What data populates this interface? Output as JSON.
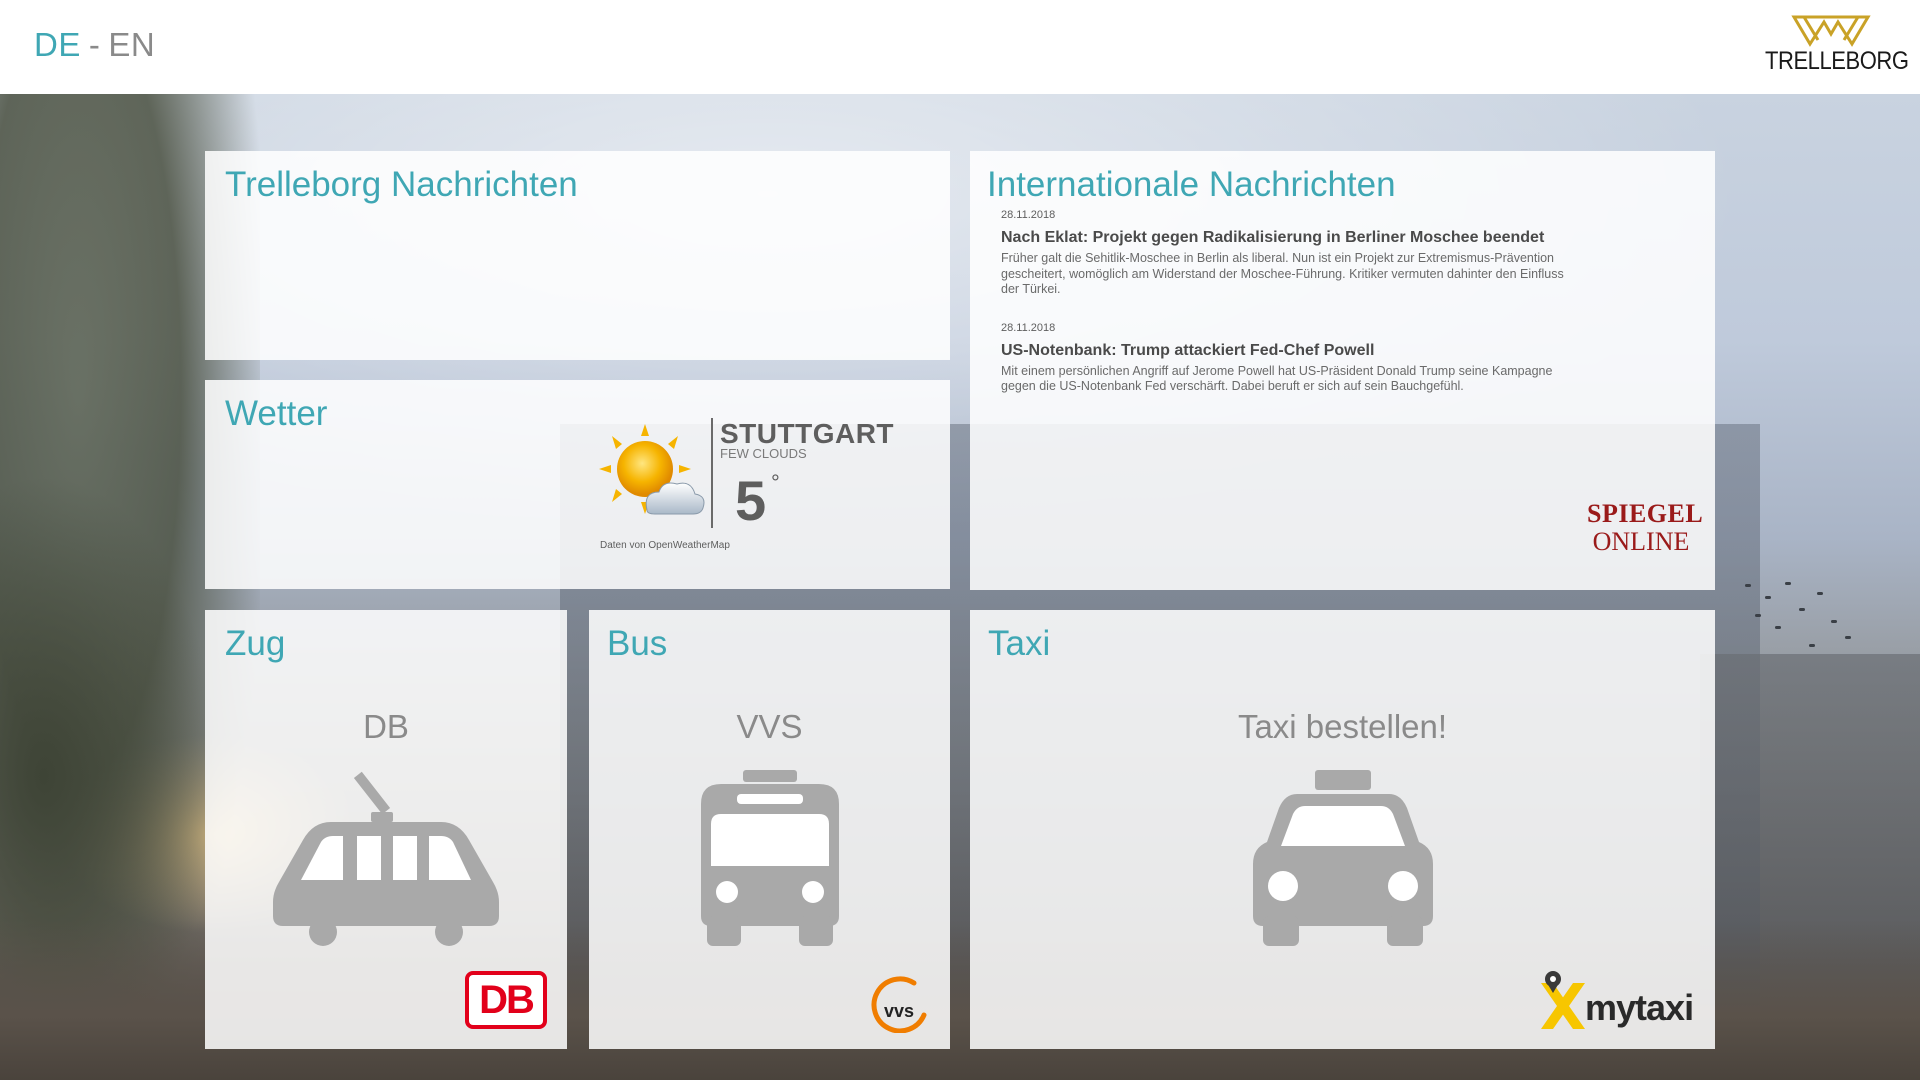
{
  "header": {
    "lang_de": "DE",
    "lang_sep": "-",
    "lang_en": "EN",
    "logo_text": "TRELLEBORG"
  },
  "panels": {
    "trelleborg_news": {
      "title": "Trelleborg Nachrichten"
    },
    "weather": {
      "title": "Wetter",
      "city": "STUTTGART",
      "condition": "FEW CLOUDS",
      "temperature": "5",
      "degree": "°",
      "credit": "Daten von OpenWeatherMap",
      "icon": "sun-with-cloud-icon"
    },
    "intl_news": {
      "title": "Internationale Nachrichten",
      "items": [
        {
          "date": "28.11.2018",
          "headline": "Nach Eklat: Projekt gegen Radikalisierung in Berliner Moschee beendet",
          "text": "Früher galt die Sehitlik-Moschee in Berlin als liberal. Nun ist ein Projekt zur Extremismus-Prävention gescheitert, womöglich am Widerstand der Moschee-Führung. Kritiker vermuten dahinter den Einfluss der Türkei."
        },
        {
          "date": "28.11.2018",
          "headline": "US-Notenbank: Trump attackiert Fed-Chef Powell",
          "text": "Mit einem persönlichen Angriff auf Jerome Powell hat US-Präsident Donald Trump seine Kampagne gegen die US-Notenbank Fed verschärft. Dabei beruft er sich auf sein Bauchgefühl."
        }
      ],
      "source_logo_line1": "SPIEGEL",
      "source_logo_line2": "ONLINE"
    },
    "train": {
      "title": "Zug",
      "label": "DB",
      "icon": "tram-icon",
      "logo_text": "DB"
    },
    "bus": {
      "title": "Bus",
      "label": "VVS",
      "icon": "bus-icon",
      "logo_text": "vvs"
    },
    "taxi": {
      "title": "Taxi",
      "label": "Taxi bestellen!",
      "icon": "taxi-icon",
      "logo_text": "mytaxi"
    }
  },
  "colors": {
    "accent": "#3fa7b4",
    "icon_gray": "#a9a9a9",
    "db_red": "#e2001a",
    "vvs_orange": "#f07d00",
    "mytaxi_yellow": "#f7c600",
    "spiegel_red": "#9a1a1a"
  }
}
